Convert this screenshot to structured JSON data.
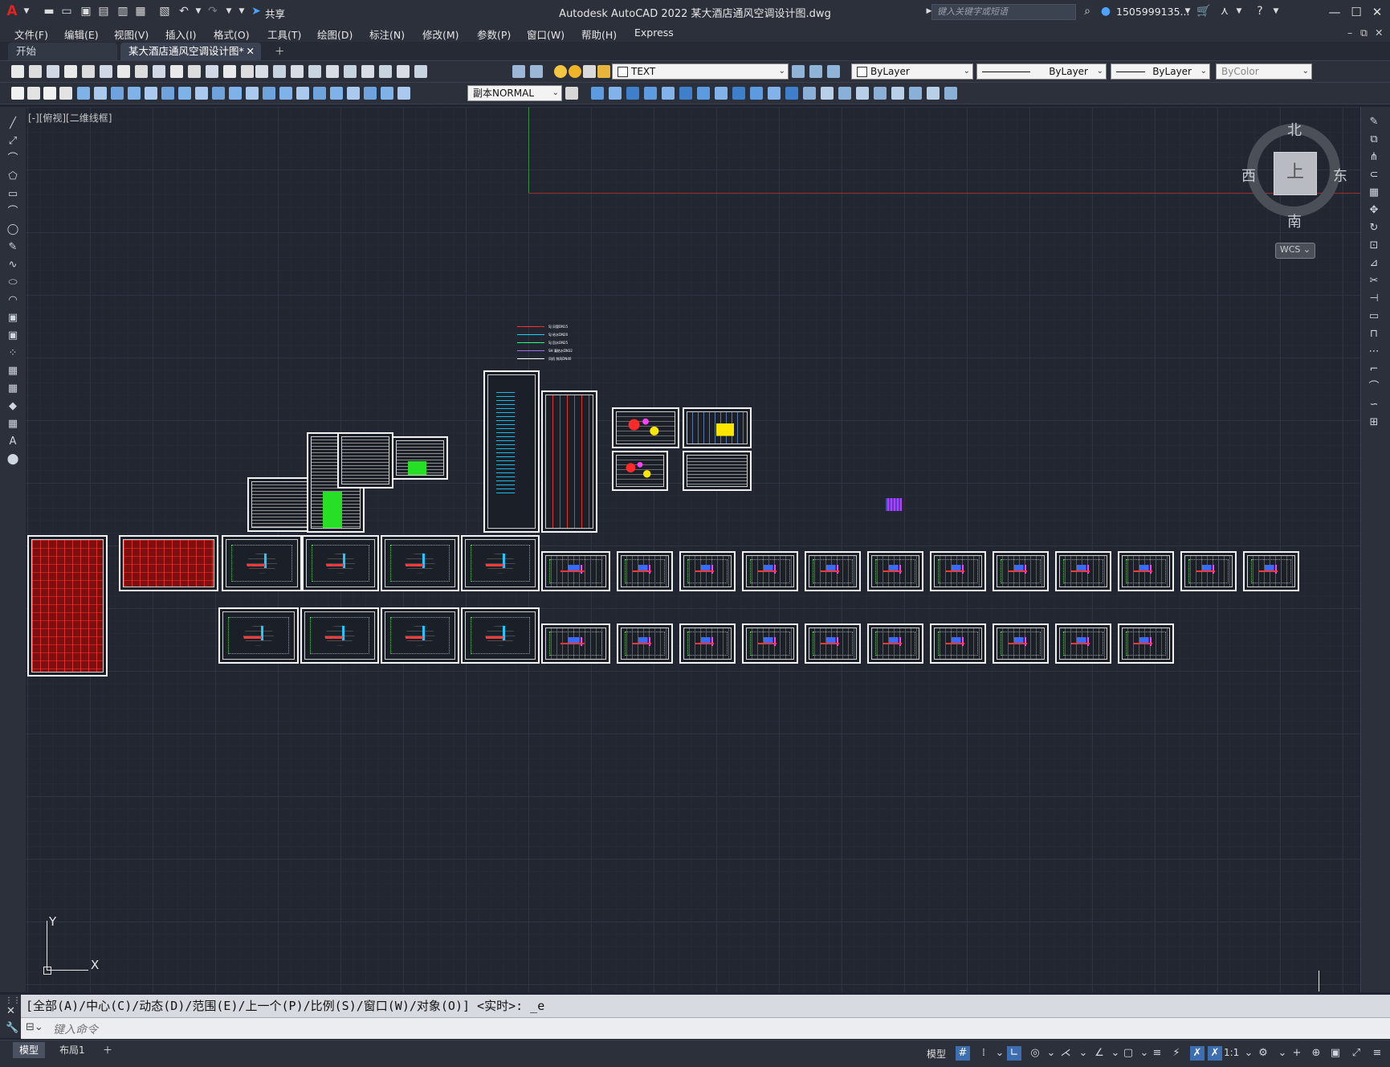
{
  "app": {
    "window_title": "Autodesk AutoCAD 2022    某大酒店通风空调设计图.dwg",
    "share_label": "共享",
    "search_placeholder": "键入关键字或短语",
    "user": "1505999135...",
    "menu": [
      "文件(F)",
      "编辑(E)",
      "视图(V)",
      "插入(I)",
      "格式(O)",
      "工具(T)",
      "绘图(D)",
      "标注(N)",
      "修改(M)",
      "参数(P)",
      "窗口(W)",
      "帮助(H)",
      "Express"
    ],
    "tabs": [
      {
        "label": "开始",
        "active": false
      },
      {
        "label": "某大酒店通风空调设计图*",
        "active": true
      }
    ]
  },
  "toolbar": {
    "layer_name": "TEXT",
    "color": "ByLayer",
    "linetype": "ByLayer",
    "lineweight": "ByLayer",
    "plotstyle": "ByColor",
    "dimstyle": "副本NORMAL"
  },
  "viewport": {
    "label": "[-][俯视][二维线框]",
    "compass": {
      "north": "北",
      "south": "南",
      "east": "东",
      "west": "西",
      "top": "上"
    },
    "ucs_name": "WCS",
    "axis_x": "X",
    "axis_y": "Y"
  },
  "command": {
    "history": "[全部(A)/中心(C)/动态(D)/范围(E)/上一个(P)/比例(S)/窗口(W)/对象(O)] <实时>: _e",
    "placeholder": "键入命令"
  },
  "status": {
    "layout_tabs": [
      "模型",
      "布局1"
    ],
    "model_label": "模型",
    "scale": "1:1"
  },
  "legend_lines": [
    {
      "color": "#ff3030",
      "text": "SJ 风管DN15"
    },
    {
      "color": "#20d0ff",
      "text": "SJ 给水DN20"
    },
    {
      "color": "#30ff80",
      "text": "SJ 回水DN25"
    },
    {
      "color": "#a070ff",
      "text": "SH 凝结水DN32"
    },
    {
      "color": "#ffffff",
      "text": "风机 排风DN40"
    }
  ]
}
